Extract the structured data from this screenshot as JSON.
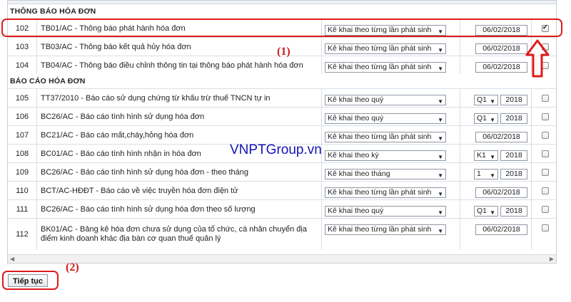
{
  "sections": [
    {
      "title": "THÔNG BÁO HÓA ĐƠN",
      "rows": [
        {
          "no": "102",
          "name": "TB01/AC - Thông báo phát hành hóa đơn",
          "freq": "Kê khai theo từng lần phát sinh",
          "date": "06/02/2018",
          "checked": true
        },
        {
          "no": "103",
          "name": "TB03/AC - Thông báo kết quả hủy hóa đơn",
          "freq": "Kê khai theo từng lần phát sinh",
          "date": "06/02/2018",
          "checked": false
        },
        {
          "no": "104",
          "name": "TB04/AC - Thông báo điều chỉnh thông tin tại thông báo phát hành hóa đơn",
          "freq": "Kê khai theo từng lần phát sinh",
          "date": "06/02/2018",
          "checked": false
        }
      ]
    },
    {
      "title": "BÁO CÁO HÓA ĐƠN",
      "rows": [
        {
          "no": "105",
          "name": "TT37/2010 - Báo cáo sử dụng chứng từ khấu trừ thuế TNCN tự in",
          "freq": "Kê khai theo quý",
          "period": "Q1",
          "year": "2018",
          "checked": false
        },
        {
          "no": "106",
          "name": "BC26/AC - Báo cáo tình hình sử dụng hóa đơn",
          "freq": "Kê khai theo quý",
          "period": "Q1",
          "year": "2018",
          "checked": false
        },
        {
          "no": "107",
          "name": "BC21/AC - Báo cáo mất,cháy,hỏng hóa đơn",
          "freq": "Kê khai theo từng lần phát sinh",
          "date": "06/02/2018",
          "checked": false
        },
        {
          "no": "108",
          "name": "BC01/AC - Báo cáo tình hình nhận in hóa đơn",
          "freq": "Kê khai theo kỳ",
          "period": "K1",
          "year": "2018",
          "checked": false
        },
        {
          "no": "109",
          "name": "BC26/AC - Báo cáo tình hình sử dụng hóa đơn - theo tháng",
          "freq": "Kê khai theo tháng",
          "period": "1",
          "year": "2018",
          "checked": false
        },
        {
          "no": "110",
          "name": "BCT/AC-HĐĐT - Báo cáo về việc truyền hóa đơn điện tử",
          "freq": "Kê khai theo từng lần phát sinh",
          "date": "06/02/2018",
          "checked": false
        },
        {
          "no": "111",
          "name": "BC26/AC - Báo cáo tình hình sử dụng hóa đơn theo số lượng",
          "freq": "Kê khai theo quý",
          "period": "Q1",
          "year": "2018",
          "checked": false
        },
        {
          "no": "112",
          "name": "BK01/AC - Bảng kê hóa đơn chưa sử dụng của tổ chức, cá nhân chuyển địa điểm kinh doanh khác địa bàn cơ quan thuế quản lý",
          "freq": "Kê khai theo từng lần phát sinh",
          "date": "06/02/2018",
          "checked": false
        }
      ]
    }
  ],
  "continue_button": "Tiếp tục",
  "annotation_1": "(1)",
  "annotation_2": "(2)",
  "watermark": "VNPTGroup.vn",
  "colors": {
    "annotation": "#e01a1a",
    "watermark": "#1414b8",
    "grid": "#d9dee5"
  },
  "icons": {
    "dropdown": "triangle-down",
    "arrow": "up-arrow-outline"
  }
}
